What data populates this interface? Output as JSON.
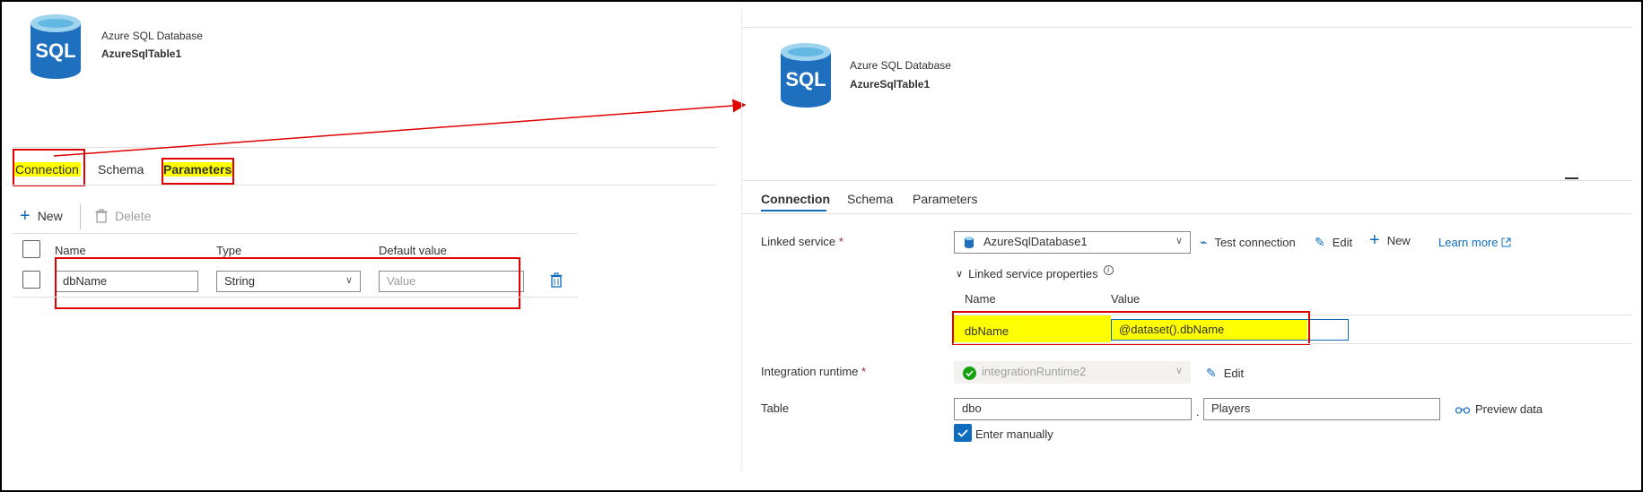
{
  "left": {
    "header": {
      "type_label": "Azure SQL Database",
      "name": "AzureSqlTable1",
      "icon_text": "SQL"
    },
    "tabs": [
      {
        "label": "Connection"
      },
      {
        "label": "Schema"
      },
      {
        "label": "Parameters"
      }
    ],
    "toolbar": {
      "new_label": "New",
      "delete_label": "Delete"
    },
    "table": {
      "headers": [
        "Name",
        "Type",
        "Default value"
      ],
      "row": {
        "name": "dbName",
        "type": "String",
        "default_placeholder": "Value"
      }
    }
  },
  "right": {
    "header": {
      "type_label": "Azure SQL Database",
      "name": "AzureSqlTable1",
      "icon_text": "SQL"
    },
    "tabs": [
      {
        "label": "Connection"
      },
      {
        "label": "Schema"
      },
      {
        "label": "Parameters"
      }
    ],
    "linked_service": {
      "label": "Linked service",
      "required_mark": "*",
      "value": "AzureSqlDatabase1",
      "test_connection": "Test connection",
      "edit": "Edit",
      "new": "New",
      "learn_more": "Learn more"
    },
    "ls_properties": {
      "title": "Linked service properties",
      "headers": [
        "Name",
        "Value"
      ],
      "row": {
        "name": "dbName",
        "value": "@dataset().dbName"
      }
    },
    "integration_runtime": {
      "label": "Integration runtime",
      "required_mark": "*",
      "value": "integrationRuntime2",
      "edit": "Edit"
    },
    "table": {
      "label": "Table",
      "schema": "dbo",
      "separator": ".",
      "table_name": "Players",
      "preview": "Preview data"
    },
    "enter_manually": "Enter manually"
  },
  "colors": {
    "highlight": "#ffff00",
    "annotation": "#e00000",
    "accent": "#0f6cbd"
  }
}
